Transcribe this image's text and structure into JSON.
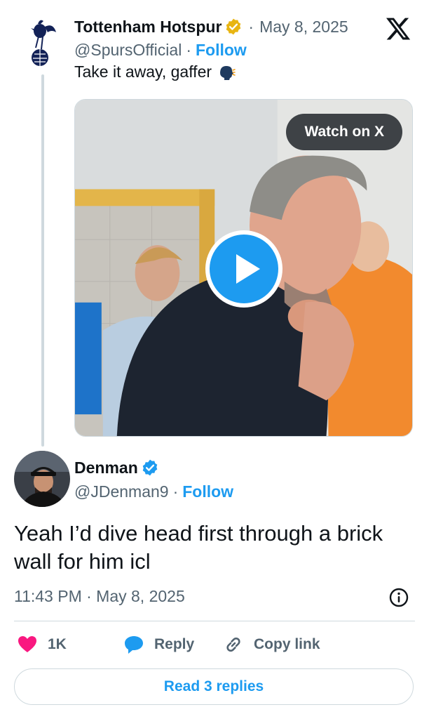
{
  "parent_tweet": {
    "author_name": "Tottenham Hotspur",
    "handle": "@SpursOfficial",
    "date": "May 8, 2025",
    "follow_label": "Follow",
    "text": "Take it away, gaffer",
    "media": {
      "watch_label": "Watch on X"
    }
  },
  "reply_tweet": {
    "author_name": "Denman",
    "handle": "@JDenman9",
    "follow_label": "Follow",
    "text": "Yeah I’d dive head first through a brick wall for him icl",
    "timestamp": "11:43 PM · May 8, 2025"
  },
  "actions": {
    "like_count": "1K",
    "reply_label": "Reply",
    "copy_link_label": "Copy link"
  },
  "read_replies_label": "Read 3 replies",
  "colors": {
    "accent": "#1d9bf0",
    "like": "#f91880",
    "gold_badge": "#e8b512",
    "text_primary": "#0f1419",
    "text_secondary": "#536471"
  },
  "icons": [
    "x-logo-icon",
    "spurs-crest-icon",
    "gold-verified-badge-icon",
    "speaking-head-emoji-icon",
    "play-icon",
    "blue-verified-badge-icon",
    "info-icon",
    "heart-icon",
    "reply-bubble-icon",
    "link-icon"
  ]
}
